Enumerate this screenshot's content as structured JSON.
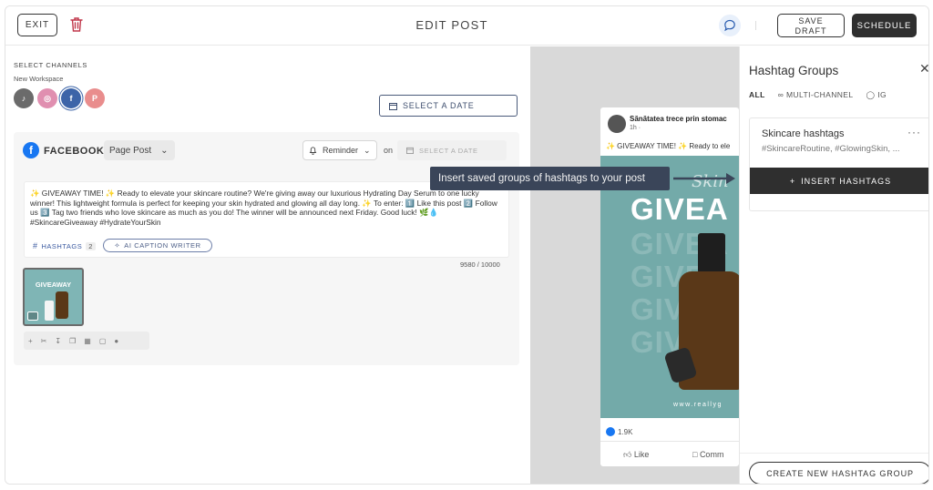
{
  "header": {
    "exit_label": "EXIT",
    "title": "EDIT POST",
    "save_draft_label": "SAVE\nDRAFT",
    "save_draft_line1": "SAVE",
    "save_draft_line2": "DRAFT",
    "schedule_label": "SCHEDULE"
  },
  "channels": {
    "section_label": "SELECT CHANNELS",
    "workspace": "New Workspace",
    "items": [
      {
        "name": "tiktok",
        "glyph": "♪",
        "color": "#6b6b6b"
      },
      {
        "name": "instagram",
        "glyph": "◎",
        "color": "#e08fb0"
      },
      {
        "name": "facebook",
        "glyph": "f",
        "color": "#3c64a8"
      },
      {
        "name": "pinterest",
        "glyph": "P",
        "color": "#e98d8d"
      }
    ],
    "select_date_label": "SELECT A DATE"
  },
  "editor": {
    "network": "FACEBOOK",
    "post_type": "Page Post",
    "reminder_label": "Reminder",
    "on_label": "on",
    "date_placeholder": "SELECT A DATE",
    "caption": "✨ GIVEAWAY TIME! ✨ Ready to elevate your skincare routine? We're giving away our luxurious Hydrating Day Serum to one lucky winner! This lightweight formula is perfect for keeping your skin hydrated and glowing all day long. ✨ To enter: 1️⃣ Like this post 2️⃣ Follow us 3️⃣ Tag two friends who love skincare as much as you do! The winner will be announced next Friday. Good luck! 🌿💧 #SkincareGiveaway #HydrateYourSkin",
    "hashtags_label": "HASHTAGS",
    "hashtags_count": "2",
    "ai_caption_label": "AI CAPTION WRITER",
    "char_count": "9580 / 10000",
    "thumb_label": "GIVEAWAY"
  },
  "preview": {
    "page_name": "Sănătatea trece prin stomac",
    "time": "1h ·",
    "text": "✨ GIVEAWAY TIME! ✨ Ready to ele",
    "image_headline": "GIVEA",
    "image_script": "Skin",
    "image_site": "www.reallyg",
    "likes_count": "1.9K",
    "like_label": "Like",
    "comment_label": "Comm"
  },
  "tooltip": {
    "text": "Insert saved groups of hashtags to your post"
  },
  "hashtag_panel": {
    "title": "Hashtag Groups",
    "tabs": [
      "ALL",
      "MULTI-CHANNEL",
      "IG"
    ],
    "group": {
      "name": "Skincare hashtags",
      "tags": "#SkincareRoutine, #GlowingSkin, ...",
      "menu": "···"
    },
    "insert_label": "INSERT HASHTAGS",
    "create_label": "CREATE NEW HASHTAG GROUP"
  }
}
